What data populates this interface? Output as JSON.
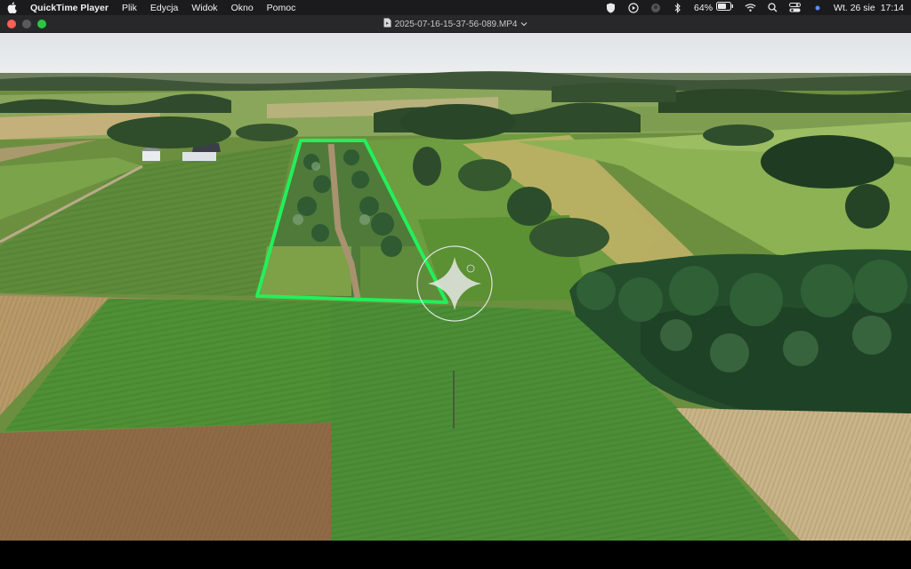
{
  "menubar": {
    "app_name": "QuickTime Player",
    "menus": [
      "Plik",
      "Edycja",
      "Widok",
      "Okno",
      "Pomoc"
    ],
    "battery_percent": "64%",
    "datetime_day": "Wt. 26 sie",
    "datetime_time": "17:14"
  },
  "window": {
    "title": "2025-07-16-15-37-56-089.MP4"
  },
  "colors": {
    "plot_outline": "#22f05a",
    "close": "#ff5f57",
    "maximize": "#28c840"
  }
}
